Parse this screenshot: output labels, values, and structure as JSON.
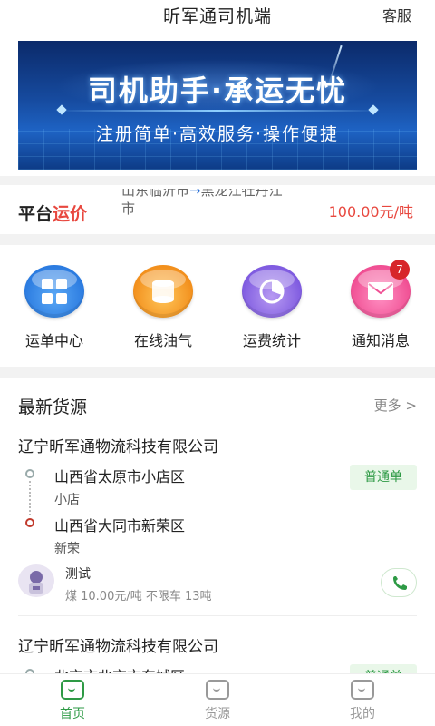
{
  "header": {
    "title": "昕军通司机端",
    "service": "客服"
  },
  "banner": {
    "headline": "司机助手·承运无忧",
    "subline": "注册简单·高效服务·操作便捷"
  },
  "ticker": {
    "brand_part1": "平台",
    "brand_part2": "运价",
    "route_line1_from": "山东临沂市",
    "route_arrow": "→",
    "route_line1_to": "黑龙江牡丹江",
    "route_line2": "市",
    "price": "100.00元/吨"
  },
  "menu": [
    {
      "label": "运单中心",
      "icon": "grid-icon",
      "color": "#2b7be0"
    },
    {
      "label": "在线油气",
      "icon": "oil-drum-icon",
      "color": "#f28f1c"
    },
    {
      "label": "运费统计",
      "icon": "pie-chart-icon",
      "color": "#7f5be0"
    },
    {
      "label": "通知消息",
      "icon": "mail-icon",
      "color": "#f04f93",
      "badge": "7"
    }
  ],
  "latest": {
    "title": "最新货源",
    "more": "更多 >",
    "cards": [
      {
        "company": "辽宁昕军通物流科技有限公司",
        "tag": "普通单",
        "from": "山西省太原市小店区",
        "from_detail": "小店",
        "to": "山西省大同市新荣区",
        "to_detail": "新荣",
        "shipper": "测试",
        "goods": "煤 10.00元/吨 不限车 13吨"
      },
      {
        "company": "辽宁昕军通物流科技有限公司",
        "tag": "普通单",
        "from": "北京市北京市东城区"
      }
    ]
  },
  "tabs": [
    {
      "label": "首页",
      "active": true
    },
    {
      "label": "货源",
      "active": false
    },
    {
      "label": "我的",
      "active": false
    }
  ],
  "colors": {
    "accent_green": "#2e9a45",
    "price_red": "#e8483f",
    "badge_red": "#d7262a"
  }
}
